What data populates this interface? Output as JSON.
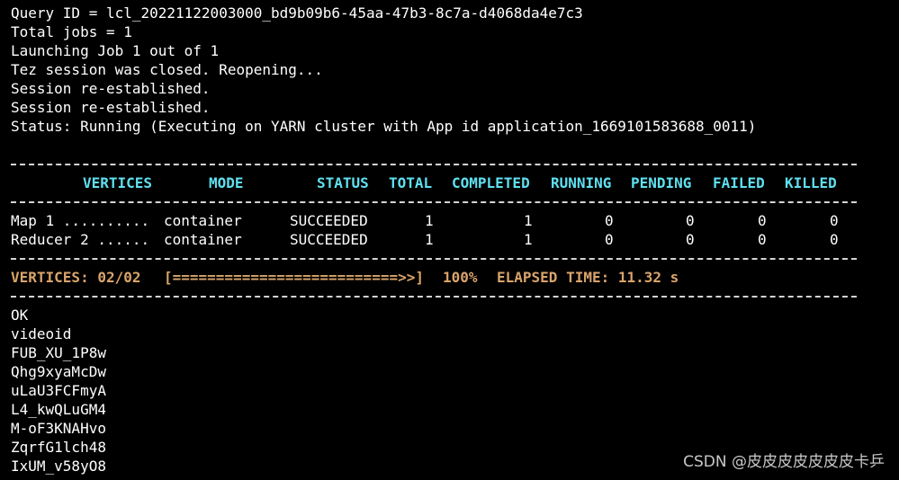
{
  "colors": {
    "background": "#000000",
    "text": "#ffffff",
    "header": "#5fe0f0",
    "summary": "#d9a46b",
    "rule": "#d4d4d4",
    "watermark": "#c8c8c8"
  },
  "log_top": [
    "Query ID = lcl_20221122003000_bd9b09b6-45aa-47b3-8c7a-d4068da4e7c3",
    "Total jobs = 1",
    "Launching Job 1 out of 1",
    "Tez session was closed. Reopening...",
    "Session re-established.",
    "Session re-established.",
    "Status: Running (Executing on YARN cluster with App id application_1669101583688_0011)"
  ],
  "table": {
    "headers": [
      "VERTICES",
      "MODE",
      "STATUS",
      "TOTAL",
      "COMPLETED",
      "RUNNING",
      "PENDING",
      "FAILED",
      "KILLED"
    ],
    "rows": [
      [
        "Map 1 ..........",
        "container",
        "SUCCEEDED",
        "1",
        "1",
        "0",
        "0",
        "0",
        "0"
      ],
      [
        "Reducer 2 ......",
        "container",
        "SUCCEEDED",
        "1",
        "1",
        "0",
        "0",
        "0",
        "0"
      ]
    ]
  },
  "summary": {
    "vertices": "VERTICES: 02/02",
    "progress_bar": "[==========================>>]",
    "percent": "100%",
    "elapsed": "ELAPSED TIME: 11.32 s"
  },
  "log_bottom": [
    "OK",
    "videoid",
    "FUB_XU_1P8w",
    "Qhg9xyaMcDw",
    "uLaU3FCFmyA",
    "L4_kwQLuGM4",
    "M-oF3KNAHvo",
    "ZqrfG1lch48",
    "IxUM_v58yO8"
  ],
  "watermark": "CSDN @皮皮皮皮皮皮皮卡乒"
}
